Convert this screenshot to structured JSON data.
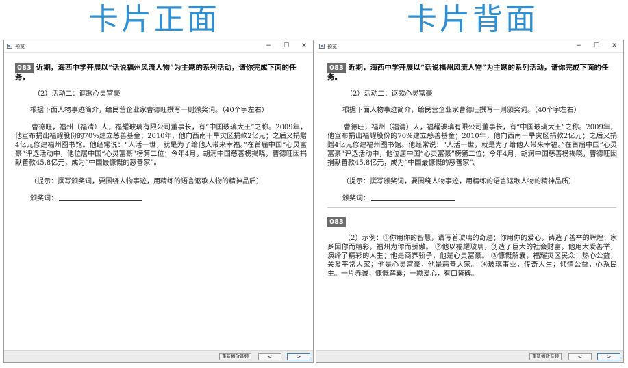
{
  "labels": {
    "front": "卡片正面",
    "back": "卡片背面"
  },
  "window": {
    "title": "预览",
    "minimize": "−",
    "maximize": "☐",
    "close": "✕"
  },
  "question": {
    "number": "083",
    "stem": "近期，海西中学开展以“话说福州风流人物”为主题的系列活动，请你完成下面的任务。",
    "sub_task": "（2）活动二：讴歌心灵富豪",
    "instruction": "根据下面人物事迹简介，给民营企业家曹德旺撰写一则颁奖词。（40个字左右）",
    "body": "曹德旺，福州（福清）人，福耀玻璃有限公司董事长，有“中国玻璃大王”之称。2009年，他宣布捐出福耀股份的70%建立慈善基金；2010年，他向西南干旱灾区捐款2亿元；之后又捐赠4亿元修建福州图书馆。他经常说：“人活一世，就是为了给他人带来幸福。”在首届中国“心灵富豪”评选活动中，他位居中国“心灵富豪”榜第二位；今年4月，胡润中国慈善榜揭晓，曹德旺因捐献善款45.8亿元，成为“中国最慷慨的慈善家”。",
    "hint": "（提示：撰写颁奖词，要围绕人物事迹，用精练的语言讴歌人物的精神品质）",
    "answer_label": "颁奖词："
  },
  "answer": {
    "number": "083",
    "text": "（2）示例：①你用你的智慧，谱写着玻璃的奇迹；你用你的爱心，铸造了善举的辉煌；家乡因你而精彩，福州为你而骄傲。 ②他以福耀玻璃，创造了巨大的社会财富，他用大爱善举，演绎了精彩的人生；他是商界骄子，他是心灵富豪。 ③慷慨解囊，福耀灾区民众；热心公益，关爱平常人家；他是心灵富豪，他是慈善大家。 ④玻璃事业，传奇人生；倾情公益，心系民生。一片赤诚，慷慨解囊；一颗爱心，有口皆碑。"
  },
  "statusbar": {
    "replay": "重新播放音频",
    "prev": "<",
    "next": ">"
  }
}
